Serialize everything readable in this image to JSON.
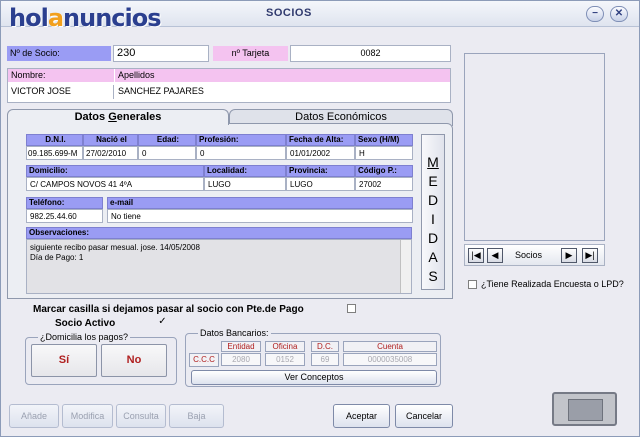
{
  "window": {
    "title": "SOCIOS",
    "logo_pre": "hol",
    "logo_accent": "a",
    "logo_post": "nuncios"
  },
  "header": {
    "num_socio_label": "Nº de Socio:",
    "num_socio_value": "230",
    "tarjeta_label": "nº Tarjeta",
    "tarjeta_value": "0082",
    "nombre_label": "Nombre:",
    "apellidos_label": "Apellidos",
    "nombre_value": "VICTOR JOSE",
    "apellidos_value": "SANCHEZ PAJARES"
  },
  "tabs": {
    "general": "Datos Generales",
    "general_accel": "G",
    "economicos": "Datos Económicos"
  },
  "general": {
    "dni_label": "D.N.I.",
    "dni_value": "09.185.699-M",
    "nacio_label": "Nació el",
    "nacio_value": "27/02/2010",
    "edad_label": "Edad:",
    "edad_value": "0",
    "profesion_label": "Profesión:",
    "profesion_value": "0",
    "alta_label": "Fecha de Alta:",
    "alta_value": "01/01/2002",
    "sexo_label": "Sexo (H/M)",
    "sexo_value": "H",
    "domicilio_label": "Domicilio:",
    "domicilio_value": "C/ CAMPOS NOVOS 41 4ºA",
    "localidad_label": "Localidad:",
    "localidad_value": "LUGO",
    "provincia_label": "Provincia:",
    "provincia_value": "LUGO",
    "cp_label": "Código P.:",
    "cp_value": "27002",
    "telefono_label": "Teléfono:",
    "telefono_value": "982.25.44.60",
    "email_label": "e-mail",
    "email_value": "No tiene",
    "obs_label": "Observaciones:",
    "obs_line1": "siguiente recibo pasar mesual. jose. 14/05/2008",
    "obs_line2": "Día de Pago: 1"
  },
  "medidas": [
    "M",
    "E",
    "D",
    "I",
    "D",
    "A",
    "S"
  ],
  "options": {
    "pte_pago_label": "Marcar casilla si dejamos pasar al socio con Pte.de Pago",
    "activo_label": "Socio Activo",
    "activo_check": "✓"
  },
  "domicilia": {
    "title": "¿Domicilia los pagos?",
    "si": "Sí",
    "no": "No"
  },
  "bancarios": {
    "title": "Datos Bancarios:",
    "entidad": "Entidad",
    "oficina": "Oficina",
    "dc": "D.C.",
    "cuenta": "Cuenta",
    "ccc": "C.C.C",
    "entidad_v": "2080",
    "oficina_v": "0152",
    "dc_v": "69",
    "cuenta_v": "0000035008",
    "ver_conceptos": "Ver Conceptos"
  },
  "navigator": {
    "label": "Socios",
    "first": "|◀",
    "prev": "◀",
    "next": "▶",
    "last": "▶|"
  },
  "encuesta_label": "¿Tiene Realizada Encuesta o LPD?",
  "buttons": {
    "anadir": "Añade",
    "modifica": "Modifica",
    "consulta": "Consulta",
    "baja": "Baja",
    "aceptar": "Aceptar",
    "cancelar": "Cancelar"
  },
  "titlebar_icons": {
    "minimize": "−",
    "close": "✕"
  }
}
